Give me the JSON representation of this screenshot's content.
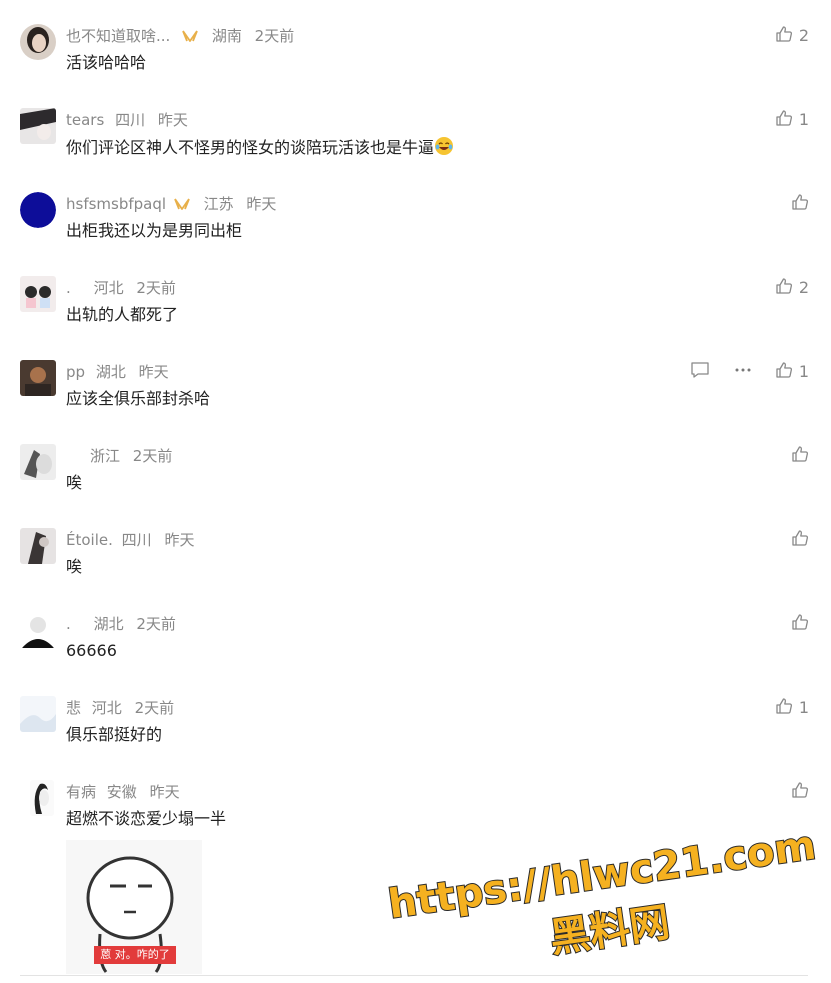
{
  "comments": [
    {
      "name": "也不知道取啥...",
      "badge": true,
      "region": "湖南",
      "time": "2天前",
      "text": "活该哈哈哈",
      "likes": "2"
    },
    {
      "name": "tears",
      "badge": false,
      "region": "四川",
      "time": "昨天",
      "text": "你们评论区神人不怪男的怪女的谈陪玩活该也是牛逼",
      "likes": "1"
    },
    {
      "name": "hsfsmsbfpaql",
      "badge": true,
      "region": "江苏",
      "time": "昨天",
      "text": "出柜我还以为是男同出柜",
      "likes": ""
    },
    {
      "name": ".",
      "badge": false,
      "region": "河北",
      "time": "2天前",
      "text": "出轨的人都死了",
      "likes": "2"
    },
    {
      "name": "pp",
      "badge": false,
      "region": "湖北",
      "time": "昨天",
      "text": "应该全俱乐部封杀哈",
      "likes": "1"
    },
    {
      "name": "",
      "badge": false,
      "region": "浙江",
      "time": "2天前",
      "text": "唉",
      "likes": ""
    },
    {
      "name": "Étoile.",
      "badge": false,
      "region": "四川",
      "time": "昨天",
      "text": "唉",
      "likes": ""
    },
    {
      "name": ".",
      "badge": false,
      "region": "湖北",
      "time": "2天前",
      "text": "66666",
      "likes": ""
    },
    {
      "name": "悲",
      "badge": false,
      "region": "河北",
      "time": "2天前",
      "text": "俱乐部挺好的",
      "likes": "1"
    },
    {
      "name": "有病",
      "badge": false,
      "region": "安徽",
      "time": "昨天",
      "text": "超燃不谈恋爱少塌一半",
      "likes": ""
    }
  ],
  "sticker": {
    "caption": "蒽 对。咋的了"
  },
  "watermark": {
    "line1": "https://hlwc21.com",
    "line2": "黑料网"
  },
  "colors": {
    "meta": "#888888",
    "badge": "#e8b04a",
    "text": "#222222",
    "watermark_fill": "#f5b120",
    "watermark_stroke": "#2a2a2a"
  }
}
